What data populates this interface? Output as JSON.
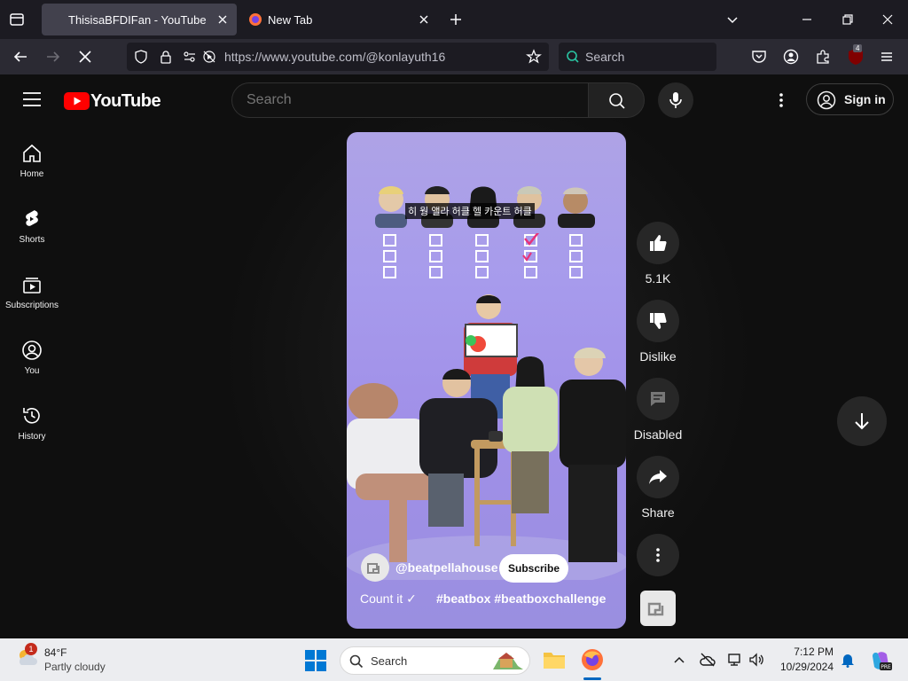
{
  "browser": {
    "tabs": [
      {
        "label": "ThisisaBFDIFan - YouTube",
        "active": true
      },
      {
        "label": "New Tab",
        "active": false
      }
    ],
    "url": "https://www.youtube.com/@konlayuth16",
    "search_placeholder": "Search",
    "extension_badge": "4"
  },
  "youtube": {
    "logo_text": "YouTube",
    "search_placeholder": "Search",
    "sign_in_label": "Sign in",
    "sidebar": [
      {
        "label": "Home",
        "icon": "home-icon"
      },
      {
        "label": "Shorts",
        "icon": "shorts-icon"
      },
      {
        "label": "Subscriptions",
        "icon": "subscriptions-icon"
      },
      {
        "label": "You",
        "icon": "you-icon"
      },
      {
        "label": "History",
        "icon": "history-icon"
      }
    ],
    "short": {
      "overlay_caption": "히 웡 앨라 허클 헬 카운트 허클",
      "channel": "@beatpellahouse",
      "subscribe_label": "Subscribe",
      "title": "Count it ✓",
      "hashtags": "#beatbox #beatboxchallenge"
    },
    "actions": {
      "like_count": "5.1K",
      "dislike_label": "Dislike",
      "comments_label": "Disabled",
      "share_label": "Share"
    }
  },
  "taskbar": {
    "weather_temp": "84°F",
    "weather_desc": "Partly cloudy",
    "weather_badge": "1",
    "search_placeholder": "Search",
    "time": "7:12 PM",
    "date": "10/29/2024"
  },
  "colors": {
    "yt_red": "#ff0000",
    "yt_bg": "#0f0f0f",
    "video_bg": "#a79bec"
  }
}
